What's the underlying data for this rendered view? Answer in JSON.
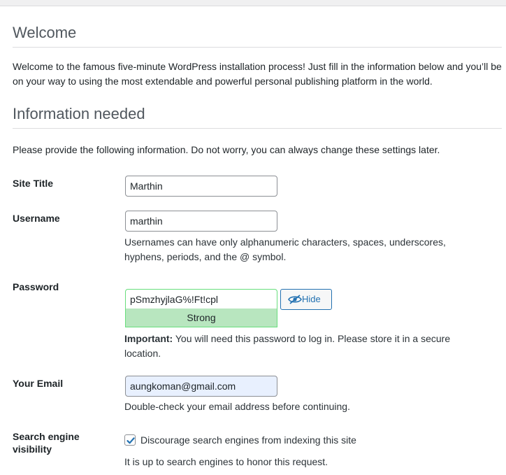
{
  "welcome": {
    "title": "Welcome",
    "text": "Welcome to the famous five-minute WordPress installation process! Just fill in the information below and you’ll be on your way to using the most extendable and powerful personal publishing platform in the world."
  },
  "info": {
    "title": "Information needed",
    "text": "Please provide the following information. Do not worry, you can always change these settings later."
  },
  "form": {
    "site_title": {
      "label": "Site Title",
      "value": "Marthin"
    },
    "username": {
      "label": "Username",
      "value": "marthin",
      "help": "Usernames can have only alphanumeric characters, spaces, underscores, hyphens, periods, and the @ symbol."
    },
    "password": {
      "label": "Password",
      "value": "pSmzhyjlaG%!Ft!cpl",
      "hide_label": "Hide",
      "hide_icon": "eye-slash-icon",
      "strength": "Strong",
      "important_label": "Important:",
      "important_text": " You will need this password to log in. Please store it in a secure location."
    },
    "email": {
      "label": "Your Email",
      "value": "aungkoman@gmail.com",
      "help": "Double-check your email address before continuing."
    },
    "search_visibility": {
      "label": "Search engine visibility",
      "checkbox_label": "Discourage search engines from indexing this site",
      "checked": true,
      "help": "It is up to search engines to honor this request."
    }
  },
  "colors": {
    "accent": "#2271b1",
    "strong_bg": "#b8e6bf",
    "strong_border": "#68de7c",
    "autofill_bg": "#e8f0fe"
  }
}
